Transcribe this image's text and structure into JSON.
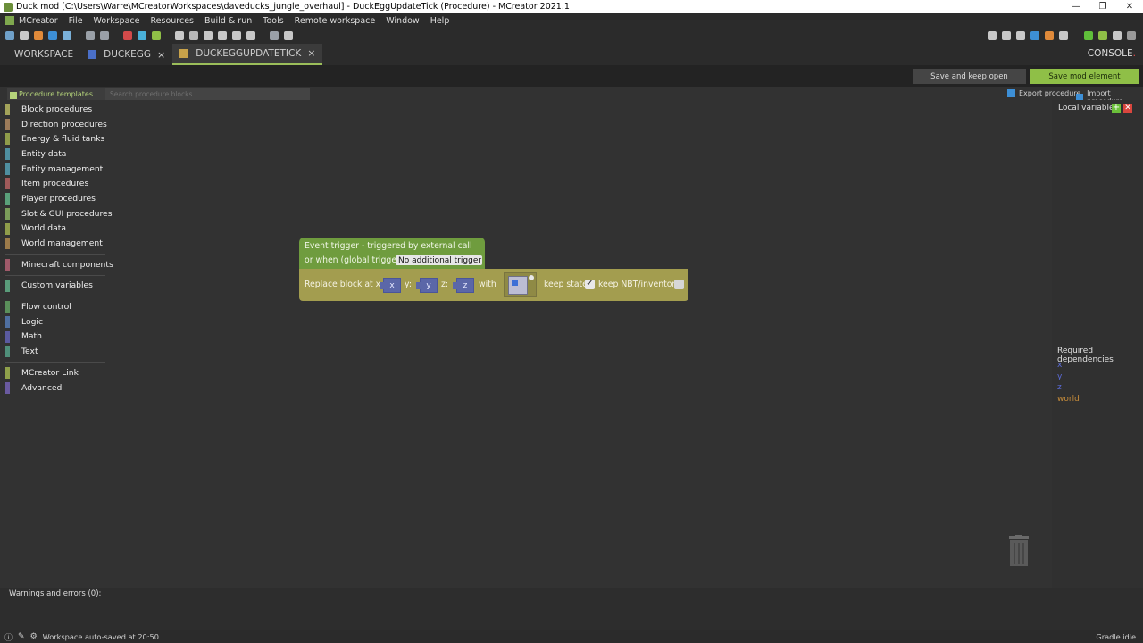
{
  "window": {
    "title": "Duck mod [C:\\Users\\Warre\\MCreatorWorkspaces\\daveducks_jungle_overhaul] - DuckEggUpdateTick (Procedure) - MCreator 2021.1",
    "minimize": "—",
    "maximize": "❐",
    "close": "✕"
  },
  "menu": [
    "MCreator",
    "File",
    "Workspace",
    "Resources",
    "Build & run",
    "Tools",
    "Remote workspace",
    "Window",
    "Help"
  ],
  "tabs": {
    "workspace": "WORKSPACE",
    "duckegg": "DUCKEGG",
    "current": "DUCKEGGUPDATETICK",
    "close": "×",
    "console": "CONSOLE",
    "console_dot": "."
  },
  "actions": {
    "save_keep_open": "Save and keep open",
    "save_mod_element": "Save mod element"
  },
  "palette": {
    "templates": "Procedure templates",
    "search_placeholder": "Search procedure blocks",
    "export": "Export procedure",
    "import": "Import procedure"
  },
  "categories": [
    {
      "label": "Block procedures",
      "color": "#a3a35a"
    },
    {
      "label": "Direction procedures",
      "color": "#9c7b5a"
    },
    {
      "label": "Energy & fluid tanks",
      "color": "#8f9c4a"
    },
    {
      "label": "Entity data",
      "color": "#4f8fa0"
    },
    {
      "label": "Entity management",
      "color": "#4f8fa0"
    },
    {
      "label": "Item procedures",
      "color": "#a05a5a"
    },
    {
      "label": "Player procedures",
      "color": "#5aa07a"
    },
    {
      "label": "Slot & GUI procedures",
      "color": "#7a9c5a"
    },
    {
      "label": "World data",
      "color": "#8f9c4a"
    },
    {
      "label": "World management",
      "color": "#9c7b4a"
    }
  ],
  "categories2": [
    {
      "label": "Minecraft components",
      "color": "#a05a6a"
    }
  ],
  "categories3": [
    {
      "label": "Custom variables",
      "color": "#5a9c7a"
    }
  ],
  "categories4": [
    {
      "label": "Flow control",
      "color": "#5a8f5a"
    },
    {
      "label": "Logic",
      "color": "#4f6fa0"
    },
    {
      "label": "Math",
      "color": "#5a5aa0"
    },
    {
      "label": "Text",
      "color": "#4f8f7a"
    }
  ],
  "categories5": [
    {
      "label": "MCreator Link",
      "color": "#8fa04a"
    },
    {
      "label": "Advanced",
      "color": "#6a5aa0"
    }
  ],
  "blocks": {
    "event_line1": "Event trigger - triggered by external call",
    "event_line2": "or when (global trigger):",
    "trigger_value": "No additional trigger",
    "replace_label": "Replace block at x:",
    "y_label": "y:",
    "z_label": "z:",
    "with_label": "with",
    "keep_state": "keep state",
    "keep_nbt": "keep NBT/inventory",
    "var_x": "x",
    "var_y": "y",
    "var_z": "z",
    "keep_state_checked": true,
    "keep_nbt_checked": false
  },
  "right_panel": {
    "local_variables": "Local variables",
    "add": "+",
    "remove": "✕",
    "required_dependencies": "Required dependencies",
    "deps": [
      "x",
      "y",
      "z",
      "world"
    ]
  },
  "bottom": {
    "warnings": "Warnings and errors (0):",
    "status": "Workspace auto-saved at 20:50",
    "gradle": "Gradle idle"
  }
}
